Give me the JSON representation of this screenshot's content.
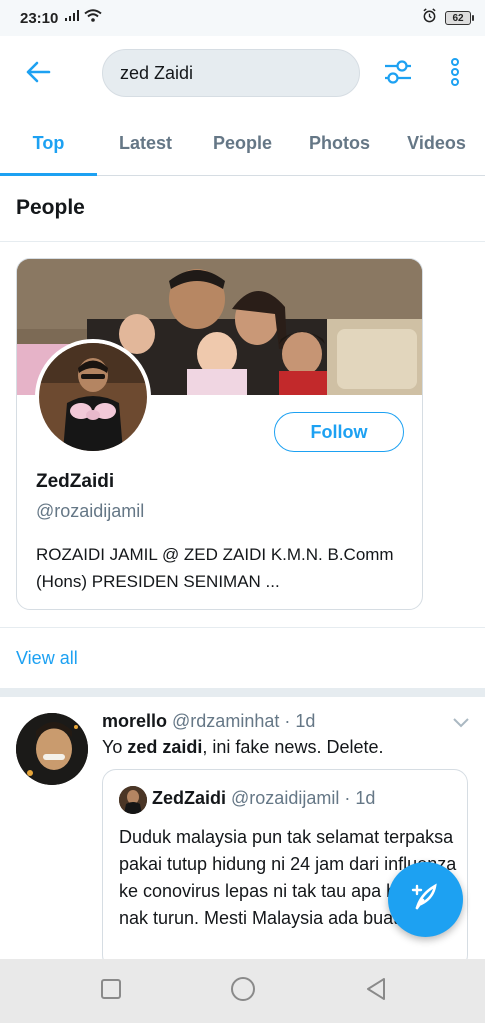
{
  "status_bar": {
    "time": "23:10",
    "battery": "62"
  },
  "search": {
    "query": "zed Zaidi"
  },
  "tabs": [
    {
      "label": "Top",
      "active": true
    },
    {
      "label": "Latest",
      "active": false
    },
    {
      "label": "People",
      "active": false
    },
    {
      "label": "Photos",
      "active": false
    },
    {
      "label": "Videos",
      "active": false
    }
  ],
  "people_section": {
    "title": "People",
    "card": {
      "name": "ZedZaidi",
      "handle": "@rozaidijamil",
      "bio": "ROZAIDI JAMIL @ ZED ZAIDI K.M.N. B.Comm (Hons) PRESIDEN SENIMAN ...",
      "follow_label": "Follow"
    },
    "view_all_label": "View all"
  },
  "tweet": {
    "name": "morello",
    "handle": "@rdzaminhat",
    "separator": "·",
    "time": "1d",
    "text_prefix": "Yo ",
    "text_highlight": "zed zaidi",
    "text_suffix": ", ini fake news. Delete.",
    "quote": {
      "name": "ZedZaidi",
      "handle": "@rozaidijamil",
      "separator": "·",
      "time": "1d",
      "text": "Duduk malaysia pun tak selamat terpaksa pakai tutup hidung ni 24 jam dari influenza ke conovirus lepas ni tak tau apa bala lagi nak turun. Mesti Malaysia ada buat ben..."
    }
  },
  "colors": {
    "accent": "#1da1f2",
    "text_primary": "#14171a",
    "text_secondary": "#657786",
    "border": "#d6dde3"
  },
  "icons": {
    "back": "arrow-left-icon",
    "filter": "sliders-icon",
    "more": "more-vertical-icon",
    "caret": "chevron-down-icon",
    "compose": "compose-feather-icon",
    "nav_recent": "square-icon",
    "nav_home": "circle-icon",
    "nav_back": "triangle-back-icon"
  }
}
